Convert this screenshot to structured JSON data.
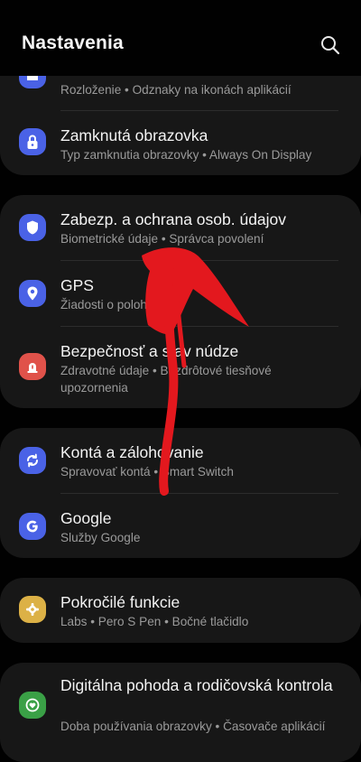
{
  "header": {
    "title": "Nastavenia",
    "search_icon": "search-icon"
  },
  "colors": {
    "background": "#010101",
    "card": "#171717",
    "blue": "#4a62e6",
    "orange_red": "#e0524a",
    "green": "#3aa046",
    "yellow": "#dcb146",
    "annotation_arrow": "#e3181e"
  },
  "items": [
    {
      "label": "",
      "sub": "Rozloženie • Odznaky na ikonách aplikácií",
      "icon": "home-icon"
    },
    {
      "label": "Zamknutá obrazovka",
      "sub": "Typ zamknutia obrazovky • Always On Display",
      "icon": "lock-icon"
    },
    {
      "label": "Zabezp. a ochrana osob. údajov",
      "sub": "Biometrické údaje • Správca povolení",
      "icon": "shield-icon"
    },
    {
      "label": "GPS",
      "sub": "Žiadosti o polohu",
      "icon": "location-pin-icon"
    },
    {
      "label": "Bezpečnosť a stav núdze",
      "sub": "Zdravotné údaje • Bezdrôtové tiesňové upozornenia",
      "icon": "emergency-icon"
    },
    {
      "label": "Kontá a zálohovanie",
      "sub": "Spravovať kontá • Smart Switch",
      "icon": "sync-icon"
    },
    {
      "label": "Google",
      "sub": "Služby Google",
      "icon": "google-icon"
    },
    {
      "label": "Pokročilé funkcie",
      "sub": "Labs • Pero S Pen • Bočné tlačidlo",
      "icon": "puzzle-gear-icon"
    },
    {
      "label": "Digitálna pohoda a rodičovská kontrola",
      "sub": "Doba používania obrazovky • Časovače aplikácií",
      "icon": "heart-circle-icon"
    }
  ],
  "annotation": {
    "type": "hand-drawn-arrow",
    "points_to": "Zabezp. a ochrana osob. údajov"
  }
}
